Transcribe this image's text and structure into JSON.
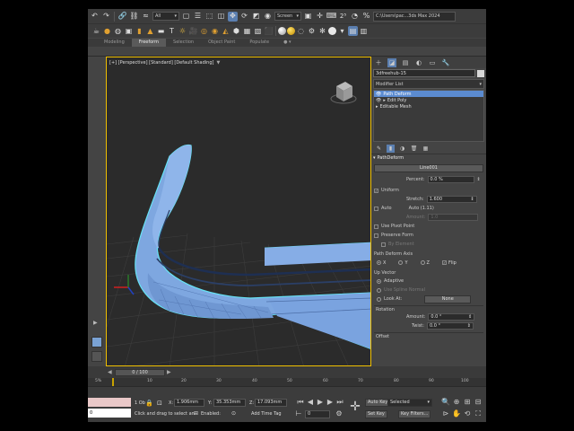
{
  "toolbar": {
    "selection_filter": "All",
    "ref_coord": "Screen",
    "file_path": "C:\\Users\\pac...3ds Max 2024"
  },
  "ribbon": {
    "tabs": [
      "Modeling",
      "Freeform",
      "Selection",
      "Object Paint",
      "Populate"
    ],
    "active_tab": "Freeform"
  },
  "viewport": {
    "label": "[+] [Perspective] [Standard] [Default Shading]"
  },
  "command_panel": {
    "object_name": "3dfreehub-15",
    "modifier_list": "Modifier List",
    "stack": [
      {
        "label": "Path Deform",
        "selected": true
      },
      {
        "label": "Edit Poly",
        "selected": false
      },
      {
        "label": "Editable Mesh",
        "selected": false
      }
    ],
    "rollout_title": "PathDeform",
    "path_button": "Line001",
    "percent_label": "Percent:",
    "percent_value": "0.0 %",
    "uniform_label": "Uniform",
    "stretch_label": "Stretch:",
    "stretch_value": "1.600",
    "auto_label": "Auto",
    "auto_value": "Auto (1.11)",
    "amount_label": "Amount:",
    "amount_value": "1.0",
    "use_pivot_label": "Use Pivot Point",
    "preserve_form_label": "Preserve Form",
    "by_element_label": "By Element",
    "axis_group": "Path Deform Axis",
    "axis_x": "X",
    "axis_y": "Y",
    "axis_z": "Z",
    "flip_label": "Flip",
    "up_vector_group": "Up Vector",
    "adaptive_label": "Adaptive",
    "use_spline_normal_label": "Use Spline Normal",
    "look_at_label": "Look At:",
    "look_at_value": "None",
    "rotation_group": "Rotation",
    "rot_amount_label": "Amount:",
    "rot_amount_value": "0.0 °",
    "twist_label": "Twist:",
    "twist_value": "0.0 °",
    "offset_group": "Offset"
  },
  "timeline": {
    "frame_display": "0 / 100",
    "ticks": [
      "5%",
      "10",
      "20",
      "30",
      "40",
      "50",
      "60",
      "70",
      "80",
      "90",
      "100"
    ]
  },
  "status": {
    "selected_count": "1 Ob",
    "x_label": "X:",
    "x_value": "1.906mm",
    "y_label": "Y:",
    "y_value": "35.353mm",
    "z_label": "Z:",
    "z_value": "17.093mm",
    "prompt": "Click and drag to select an",
    "enabled_label": "Enabled:",
    "add_time_tag": "Add Time Tag",
    "frame_value": "0",
    "auto_key": "Auto Key",
    "selected_dropdown": "Selected",
    "set_key": "Set Key",
    "key_filters": "Key Filters...",
    "maxscript_value": "0"
  },
  "colors": {
    "accent": "#5b8bd0",
    "viewport_border": "#f0c000",
    "object": "#7ea7e0"
  }
}
